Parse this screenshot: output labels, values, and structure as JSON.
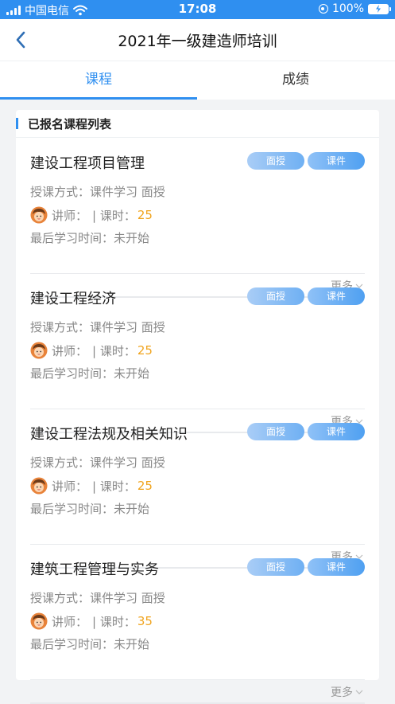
{
  "status_bar": {
    "carrier": "中国电信",
    "time": "17:08",
    "battery": "100%"
  },
  "nav": {
    "title": "2021年一级建造师培训"
  },
  "tabs": [
    {
      "label": "课程",
      "active": true
    },
    {
      "label": "成绩",
      "active": false
    }
  ],
  "section": {
    "title": "已报名课程列表"
  },
  "courses": [
    {
      "title": "建设工程项目管理",
      "tag_face": "面授",
      "tag_ware": "课件",
      "mode": "授课方式：课件学习 面授",
      "teacher_prefix": "讲师：",
      "hours_prefix": "| 课时：",
      "hours": "25",
      "last_study": "最后学习时间：未开始",
      "more": "更多"
    },
    {
      "title": "建设工程经济",
      "tag_face": "面授",
      "tag_ware": "课件",
      "mode": "授课方式：课件学习 面授",
      "teacher_prefix": "讲师：",
      "hours_prefix": "| 课时：",
      "hours": "25",
      "last_study": "最后学习时间：未开始",
      "more": "更多"
    },
    {
      "title": "建设工程法规及相关知识",
      "tag_face": "面授",
      "tag_ware": "课件",
      "mode": "授课方式：课件学习 面授",
      "teacher_prefix": "讲师：",
      "hours_prefix": "| 课时：",
      "hours": "25",
      "last_study": "最后学习时间：未开始",
      "more": "更多"
    },
    {
      "title": "建筑工程管理与实务",
      "tag_face": "面授",
      "tag_ware": "课件",
      "mode": "授课方式：课件学习 面授",
      "teacher_prefix": "讲师：",
      "hours_prefix": "| 课时：",
      "hours": "35",
      "last_study": "最后学习时间：未开始",
      "more": "更多"
    }
  ],
  "colors": {
    "accent": "#2f8ff0",
    "hours": "#f0a41e"
  }
}
